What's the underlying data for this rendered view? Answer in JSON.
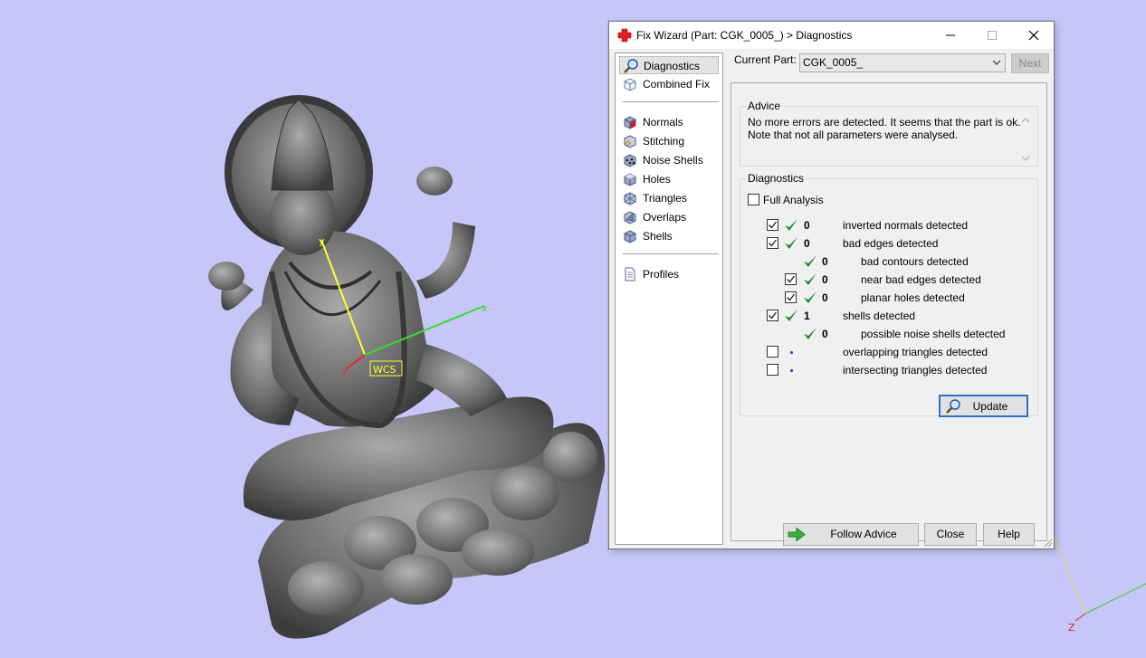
{
  "viewport": {
    "wcs_label": "WCS",
    "axis_x_label": "x",
    "axis_y_label": "y",
    "axis_z_label": "z",
    "corner_axis_label": "Z",
    "background_color": "#c6c7f8"
  },
  "dialog": {
    "title": "Fix Wizard (Part: CGK_0005_) > Diagnostics",
    "title_icon": "red-cross-icon"
  },
  "nav": {
    "group1": [
      {
        "label": "Diagnostics",
        "icon": "magnifier-icon",
        "active": true
      },
      {
        "label": "Combined Fix",
        "icon": "cube-outline-icon"
      }
    ],
    "group2": [
      {
        "label": "Normals",
        "icon": "normals-icon"
      },
      {
        "label": "Stitching",
        "icon": "stitching-icon"
      },
      {
        "label": "Noise Shells",
        "icon": "noise-shells-icon"
      },
      {
        "label": "Holes",
        "icon": "holes-icon"
      },
      {
        "label": "Triangles",
        "icon": "triangles-icon"
      },
      {
        "label": "Overlaps",
        "icon": "overlaps-icon"
      },
      {
        "label": "Shells",
        "icon": "shells-icon"
      }
    ],
    "group3": [
      {
        "label": "Profiles",
        "icon": "document-icon"
      }
    ]
  },
  "current_part": {
    "label": "Current Part:",
    "value": "CGK_0005_",
    "next_label": "Next"
  },
  "advice": {
    "title": "Advice",
    "line1": "No more errors are detected. It seems that the part is ok.",
    "line2": "Note that not all parameters were analysed."
  },
  "diagnostics": {
    "title": "Diagnostics",
    "full_analysis_label": "Full Analysis",
    "full_analysis_checked": false,
    "rows": [
      {
        "checked": true,
        "ok": true,
        "count": "0",
        "text": "inverted normals detected"
      },
      {
        "checked": true,
        "ok": true,
        "count": "0",
        "text": "bad edges detected"
      },
      {
        "checked": null,
        "ok": true,
        "count": "0",
        "text": "bad contours detected"
      },
      {
        "checked": true,
        "ok": true,
        "count": "0",
        "text": "near bad edges detected"
      },
      {
        "checked": true,
        "ok": true,
        "count": "0",
        "text": "planar holes detected"
      },
      {
        "checked": true,
        "ok": true,
        "count": "1",
        "text": "shells detected"
      },
      {
        "checked": null,
        "ok": true,
        "count": "0",
        "text": "possible noise shells detected"
      },
      {
        "checked": false,
        "ok": false,
        "count": "",
        "text": "overlapping triangles detected"
      },
      {
        "checked": false,
        "ok": false,
        "count": "",
        "text": "intersecting triangles detected"
      }
    ],
    "update_label": "Update"
  },
  "footer": {
    "follow_advice_label": "Follow Advice",
    "close_label": "Close",
    "help_label": "Help"
  }
}
